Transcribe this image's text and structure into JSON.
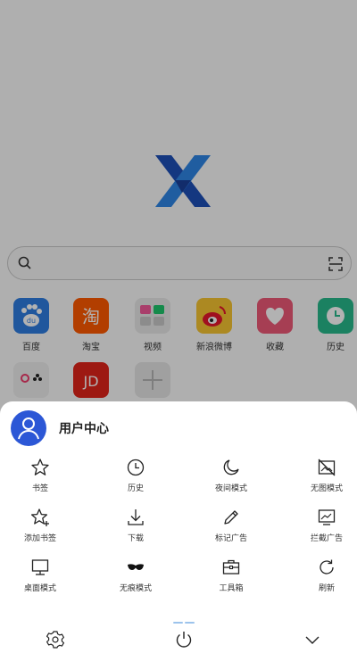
{
  "home": {
    "shortcuts": [
      {
        "label": "百度",
        "icon": "baidu-icon",
        "color": "#2f7de1"
      },
      {
        "label": "淘宝",
        "icon": "taobao-icon",
        "color": "#ff5a00"
      },
      {
        "label": "视频",
        "icon": "video-folder-icon",
        "color": "#e9e9e9"
      },
      {
        "label": "新浪微博",
        "icon": "weibo-icon",
        "color": "#f6c531"
      },
      {
        "label": "收藏",
        "icon": "heart-icon",
        "color": "#ee5a78"
      },
      {
        "label": "历史",
        "icon": "clock-icon",
        "color": "#27b98c"
      },
      {
        "label": "",
        "icon": "game-icon",
        "color": "#eeeeee"
      },
      {
        "label": "",
        "icon": "jd-icon",
        "color": "#e1251b",
        "text": "JD"
      },
      {
        "label": "",
        "icon": "add-icon",
        "color": "#e6e6e6"
      }
    ]
  },
  "menu": {
    "user_center": "用户中心",
    "items": [
      {
        "label": "书签",
        "icon": "star-icon"
      },
      {
        "label": "历史",
        "icon": "clock-icon"
      },
      {
        "label": "夜间模式",
        "icon": "moon-icon"
      },
      {
        "label": "无图模式",
        "icon": "no-image-icon"
      },
      {
        "label": "添加书签",
        "icon": "star-add-icon"
      },
      {
        "label": "下载",
        "icon": "download-icon"
      },
      {
        "label": "标记广告",
        "icon": "pencil-icon"
      },
      {
        "label": "拦截广告",
        "icon": "ad-block-icon"
      },
      {
        "label": "桌面模式",
        "icon": "desktop-icon"
      },
      {
        "label": "无痕模式",
        "icon": "mask-icon"
      },
      {
        "label": "工具箱",
        "icon": "toolbox-icon"
      },
      {
        "label": "刷新",
        "icon": "refresh-icon"
      }
    ]
  },
  "colors": {
    "accent": "#2c57d6",
    "pager": "#9cc3ec"
  }
}
